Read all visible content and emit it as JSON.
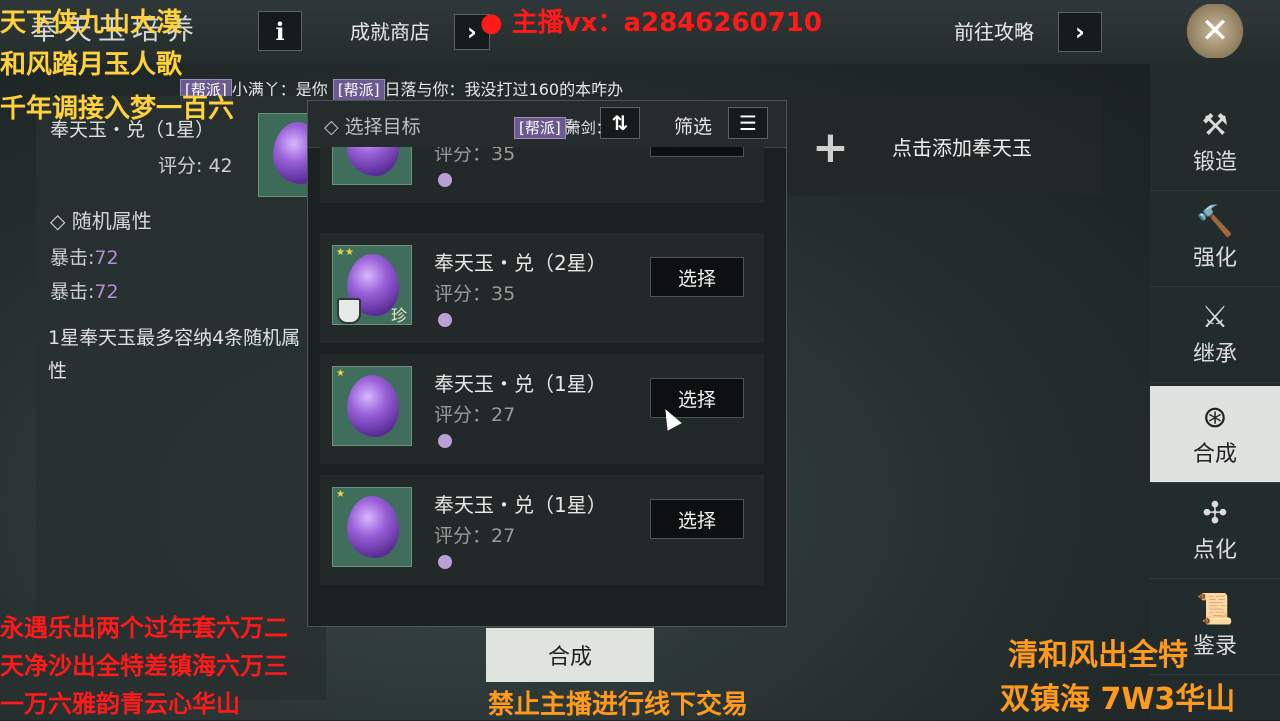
{
  "header": {
    "title": "奉天玉培养",
    "info_icon": "i",
    "achievement_shop": "成就商店",
    "guide": "前往攻略",
    "close_icon": "✕",
    "arrow_icon": "›"
  },
  "chat": {
    "tag1": "[帮派]",
    "msg1": "小满丫：是你",
    "tag2": "[帮派]",
    "msg2": "日落与你：我没打过160的本咋办",
    "tag3": "[帮派]",
    "msg3": "萧剑："
  },
  "current": {
    "name": "奉天玉・兑（1星）",
    "score": "评分: 42",
    "attr_title": "随机属性",
    "attrs": [
      {
        "label": "暴击:",
        "value": "72"
      },
      {
        "label": "暴击:",
        "value": "72"
      }
    ],
    "desc": "1星奉天玉最多容纳4条随机属性"
  },
  "add_slot": {
    "plus": "+",
    "label": "点击添加奉天玉"
  },
  "popup": {
    "target": "◇ 选择目标",
    "sort": "升序",
    "filter": "筛选",
    "items": [
      {
        "name": "",
        "score": "评分：35",
        "button": "选择",
        "stars": ""
      },
      {
        "name": "奉天玉・兑（2星）",
        "score": "评分：35",
        "button": "选择",
        "stars": "★★",
        "rare": "珍"
      },
      {
        "name": "奉天玉・兑（1星）",
        "score": "评分：27",
        "button": "选择",
        "stars": "★"
      },
      {
        "name": "奉天玉・兑（1星）",
        "score": "评分：27",
        "button": "选择",
        "stars": "★"
      }
    ]
  },
  "nav": [
    {
      "icon": "anvil-icon",
      "glyph": "⚒",
      "label": "锻造"
    },
    {
      "icon": "hammer-icon",
      "glyph": "🔨",
      "label": "强化"
    },
    {
      "icon": "inherit-icon",
      "glyph": "⚔",
      "label": "继承"
    },
    {
      "icon": "merge-icon",
      "glyph": "⊛",
      "label": "合成"
    },
    {
      "icon": "refine-icon",
      "glyph": "✣",
      "label": "点化"
    },
    {
      "icon": "scroll-icon",
      "glyph": "📜",
      "label": "鉴录"
    }
  ],
  "combine_button": "合成",
  "overlays": {
    "tl1": "天下侠九山大漠",
    "tl2": "和风踏月玉人歌",
    "tl3": "千年调接入梦一百六",
    "top_red": "● 主播vx：a2846260710",
    "bl1": "永遇乐出两个过年套六万二",
    "bl2": "天净沙出全特差镇海六万三",
    "bl3": "一万六雅韵青云心华山",
    "bottom": "禁止主播进行线下交易",
    "br1": "清和风出全特",
    "br2": "双镇海 7W3华山"
  },
  "colors": {
    "accent_purple": "#b48cd6",
    "overlay_yellow": "#ffd23c",
    "overlay_red": "#ff1a1a",
    "overlay_orange": "#ff9a1a"
  }
}
